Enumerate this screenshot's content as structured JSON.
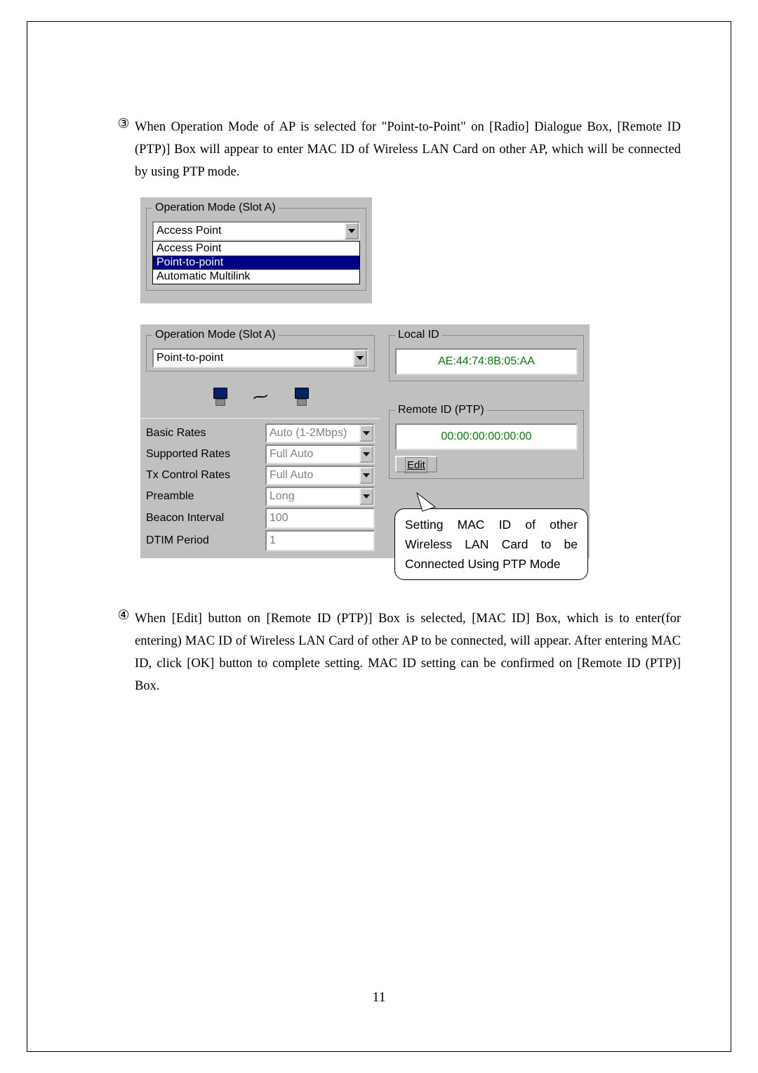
{
  "list3": {
    "marker": "③",
    "text": "When Operation Mode of AP is selected for \"Point-to-Point\" on [Radio] Dialogue Box, [Remote ID (PTP)] Box will appear to enter MAC ID of Wireless LAN Card on other AP, which will be connected by using PTP mode."
  },
  "screenshot1": {
    "legend": "Operation Mode (Slot A)",
    "selected": "Access Point",
    "options": [
      "Access Point",
      "Point-to-point",
      "Automatic Multilink"
    ]
  },
  "screenshot2": {
    "opmode": {
      "legend": "Operation Mode (Slot A)",
      "value": "Point-to-point"
    },
    "local_id": {
      "legend": "Local ID",
      "value": "AE:44:74:8B:05:AA"
    },
    "remote_id": {
      "legend": "Remote ID (PTP)",
      "value": "00:00:00:00:00:00",
      "edit_label": "Edit"
    },
    "rows": {
      "basic_rates": {
        "label": "Basic Rates",
        "value": "Auto (1-2Mbps)"
      },
      "supported_rates": {
        "label": "Supported Rates",
        "value": "Full Auto"
      },
      "tx_control_rates": {
        "label": "Tx Control Rates",
        "value": "Full Auto"
      },
      "preamble": {
        "label": "Preamble",
        "value": "Long"
      },
      "beacon_interval": {
        "label": "Beacon Interval",
        "value": "100"
      },
      "dtim_period": {
        "label": "DTIM Period",
        "value": "1"
      }
    }
  },
  "callout": "Setting MAC ID of other Wireless LAN Card to be Connected Using PTP Mode",
  "list4": {
    "marker": "④",
    "text": "When [Edit] button on [Remote ID (PTP)] Box is selected, [MAC ID] Box, which is to enter(for entering) MAC ID of Wireless LAN Card of other AP to be connected, will appear. After entering MAC ID, click [OK] button to complete setting. MAC ID setting can be confirmed on [Remote ID (PTP)] Box."
  },
  "page_number": "11"
}
